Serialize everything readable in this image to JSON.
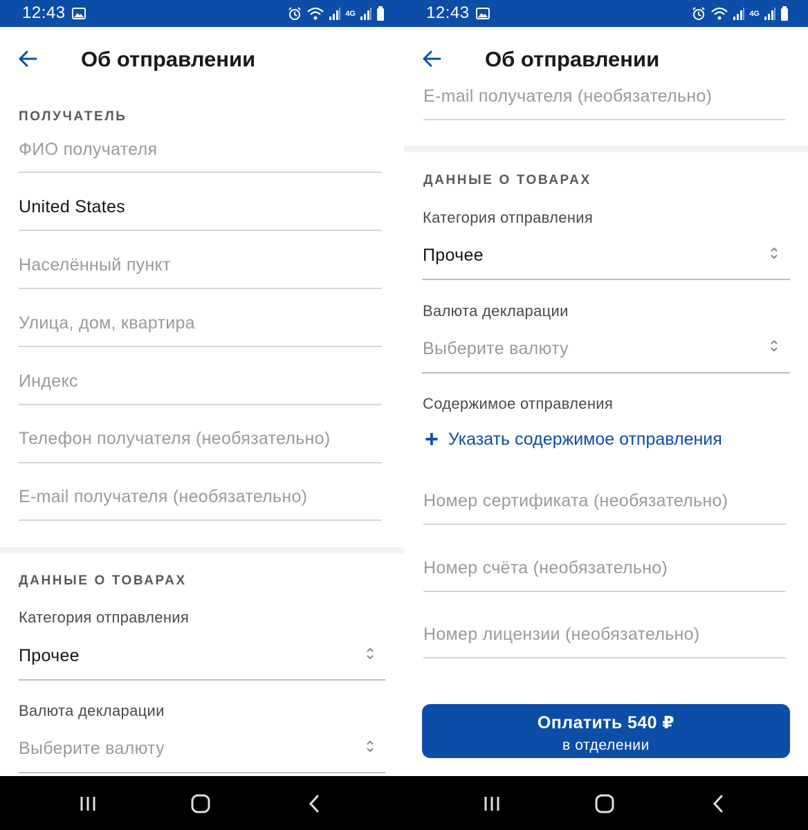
{
  "status_bar": {
    "time": "12:43",
    "network": "4G"
  },
  "header": {
    "title": "Об отправлении"
  },
  "recipient": {
    "section_label": "ПОЛУЧАТЕЛЬ",
    "fields": [
      {
        "placeholder": "ФИО получателя",
        "value": ""
      },
      {
        "placeholder": "",
        "value": "United States"
      },
      {
        "placeholder": "Населённый пункт",
        "value": ""
      },
      {
        "placeholder": "Улица, дом, квартира",
        "value": ""
      },
      {
        "placeholder": "Индекс",
        "value": ""
      },
      {
        "placeholder": "Телефон получателя (необязательно)",
        "value": ""
      },
      {
        "placeholder": "E-mail получателя (необязательно)",
        "value": ""
      }
    ]
  },
  "goods": {
    "section_label": "ДАННЫЕ О ТОВАРАХ",
    "category_label": "Категория отправления",
    "category_value": "Прочее",
    "currency_label": "Валюта декларации",
    "currency_placeholder": "Выберите валюту",
    "contents_label": "Содержимое отправления",
    "add_contents": "Указать содержимое отправления",
    "certificate_placeholder": "Номер сертификата (необязательно)",
    "invoice_placeholder": "Номер счёта (необязательно)",
    "license_placeholder": "Номер лицензии (необязательно)"
  },
  "pay_button": {
    "main": "Оплатить 540 ₽",
    "sub": "в отделении"
  },
  "icons": {
    "back": "back-arrow-icon",
    "select": "select-arrows-icon",
    "add": "plus-icon",
    "nav_recents": "recents-icon",
    "nav_home": "home-icon",
    "nav_back": "back-icon"
  },
  "colors": {
    "brand": "#0c4da8",
    "placeholder": "#9a9a9a",
    "text": "#151515"
  }
}
